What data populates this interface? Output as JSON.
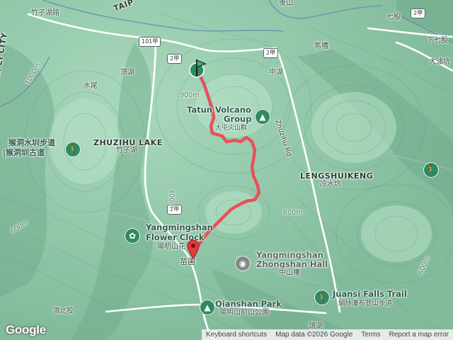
{
  "map": {
    "labels": {
      "zhuzihu_road": "竹子湖路",
      "taipei_city": "TAIPEI CITY",
      "taip_cut": "TAIP",
      "houshan": "後山",
      "qigu": "七股",
      "xiaqigu": "下七股",
      "dayoukeng": "大油坑",
      "machao": "馬槽",
      "zhonghu": "中湖",
      "dinghu": "頂湖",
      "shuiwei": "水尾",
      "zhuzihu_lake": "ZHUZIHU LAKE",
      "zhuzihu_zh": "竹子湖",
      "houkeng_trail_1": "猴洞水圳步道",
      "houkeng_trail_2": "|猴洞圳古道",
      "tatun_1": "Tatun Volcano",
      "tatun_2": "Group",
      "tatun_zh": "大屯火山群",
      "zhuzihu_rd": "Zhuzihu Rd",
      "lengshuikeng": "LENGSHUIKENG",
      "lengshuikeng_zh": "冷水坑",
      "flower_clock_1": "Yangmingshan",
      "flower_clock_2": "Flower Clock",
      "flower_clock_zh": "陽明山花",
      "miaopu": "苗圃",
      "zhongshan_hall_1": "Yangmingshan",
      "zhongshan_hall_2": "Zhongshan Hall",
      "zhongshan_hall_zh": "中山樓",
      "qianshan_park": "Qianshan Park",
      "qianshan_park_zh": "陽明山前山公園",
      "juansi_falls": "Juansi Falls Trail",
      "juansi_falls_zh": "絹絲瀑布登山步道",
      "dingbeitou": "頂北投",
      "toujia": "頭湖",
      "elev_900": "900m",
      "elev_800": "800m",
      "elev_600": "600m",
      "elev_1000": "1000m",
      "elev_400": "400m",
      "elev_600b": "600m"
    },
    "routes": {
      "r101a": "101甲",
      "r2a": "2甲",
      "r2": "2甲",
      "r2_right": "2甲",
      "r2_left": "2甲",
      "r2_bottom": "2"
    },
    "markers": {
      "start": "start-flag",
      "end": "end-pin",
      "icons": [
        "hiking-icon",
        "mountain-icon",
        "flower-icon",
        "landmark-icon",
        "park-icon",
        "waterfall-icon"
      ]
    },
    "attribution": {
      "shortcuts": "Keyboard shortcuts",
      "data": "Map data ©2026 Google",
      "terms": "Terms",
      "report": "Report a map error"
    },
    "logo": "Google",
    "colors": {
      "route": "#e8505b",
      "terrain": "#8fc7a8",
      "road": "#ffffff",
      "poi": "#2f8a64"
    }
  }
}
